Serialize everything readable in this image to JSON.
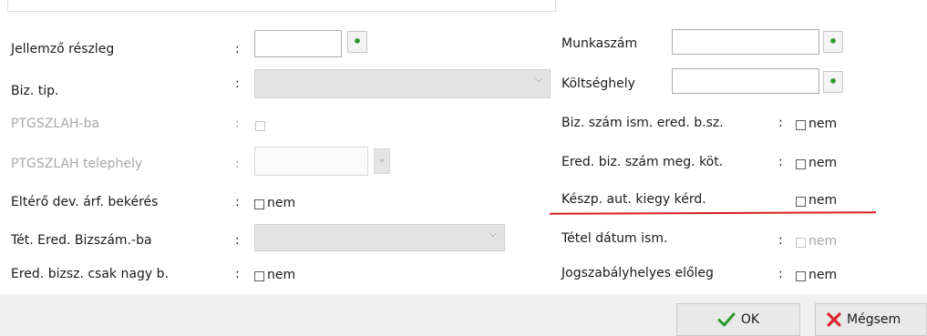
{
  "form": {
    "left": {
      "jellemzo": {
        "label": "Jellemző részleg",
        "colon": ":"
      },
      "biz_tip": {
        "label": "Biz. tip.",
        "colon": ":",
        "chevron": "⌵"
      },
      "ptgszlah_ba": {
        "label": "PTGSZLAH-ba",
        "colon": ":"
      },
      "ptgszlah_telephely": {
        "label": "PTGSZLAH telephely",
        "colon": ":",
        "button_glyph": "»"
      },
      "eltero": {
        "label": "Eltérő dev. árf. bekérés",
        "colon": ":",
        "check_label": "nem"
      },
      "tet_ered": {
        "label": "Tét. Ered. Bizszám.-ba",
        "colon": ":",
        "chevron": "⌵"
      },
      "ered_bizsz": {
        "label": "Ered. bizsz. csak nagy b.",
        "colon": ":",
        "check_label": "nem"
      }
    },
    "right": {
      "munkaszam": {
        "label": "Munkaszám"
      },
      "koltseghely": {
        "label": "Költséghely"
      },
      "biz_szam_ism": {
        "label": "Biz. szám ism. ered. b.sz.",
        "colon": ":",
        "check_label": "nem"
      },
      "ered_biz_szam": {
        "label": "Ered. biz. szám meg. köt.",
        "colon": ":",
        "check_label": "nem"
      },
      "keszp": {
        "label": "Készp. aut. kiegy kérd.",
        "check_label": "nem"
      },
      "tetel_datum": {
        "label": "Tétel dátum ism.",
        "colon": ":",
        "check_label": "nem"
      },
      "jogszabaly": {
        "label": "Jogszabályhelyes előleg",
        "colon": ":",
        "check_label": "nem"
      }
    }
  },
  "buttons": {
    "ok": {
      "label": "OK",
      "icon": "checkmark-icon"
    },
    "cancel": {
      "label": "Mégsem",
      "icon": "x-icon"
    }
  },
  "icons": {
    "plus_dot": "•"
  },
  "colors": {
    "accent_green": "#2a9a2a",
    "cancel_red": "#d9262c",
    "highlight_underline": "#d71f1f"
  }
}
